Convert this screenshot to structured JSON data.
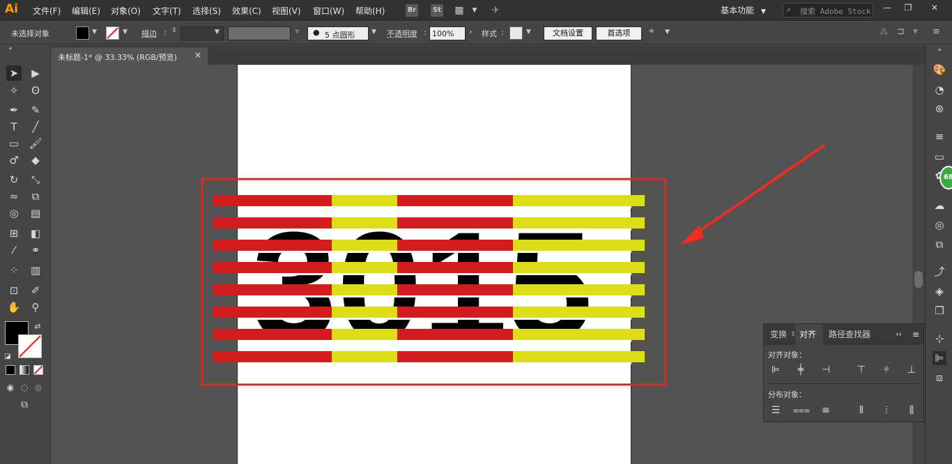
{
  "app": {
    "logo": "Ai"
  },
  "menu": [
    "文件(F)",
    "编辑(E)",
    "对象(O)",
    "文字(T)",
    "选择(S)",
    "效果(C)",
    "视图(V)",
    "窗口(W)",
    "帮助(H)"
  ],
  "menubar_icons": {
    "br": "Br",
    "st": "St"
  },
  "workspace": {
    "label": "基本功能"
  },
  "search": {
    "placeholder": "搜索 Adobe Stock"
  },
  "control": {
    "selection_status": "未选择对象",
    "stroke_label": "描边",
    "brush_value": "5 点圆形",
    "opacity_label": "不透明度",
    "opacity_value": "100%",
    "style_label": "样式",
    "doc_setup_button": "文档设置",
    "prefs_button": "首选项"
  },
  "document_tab": {
    "title": "未标题-1* @ 33.33% (RGB/预览)",
    "close": "×"
  },
  "artwork": {
    "text": "3015",
    "colors": {
      "red": "#d41c1c",
      "yellow": "#dede14",
      "text": "#000000",
      "highlight": "#e0281e",
      "arrow": "#ee2c24"
    }
  },
  "align_panel": {
    "tabs": [
      "变换",
      "对齐",
      "路径查找器"
    ],
    "active_tab": "对齐",
    "align_objects_label": "对齐对象：",
    "distribute_objects_label": "分布对象："
  },
  "badge": {
    "value": "68"
  },
  "colors": {
    "ui_bg": "#535353",
    "menubar": "#323232",
    "panel": "#454545",
    "logo": "#ff9a00"
  }
}
